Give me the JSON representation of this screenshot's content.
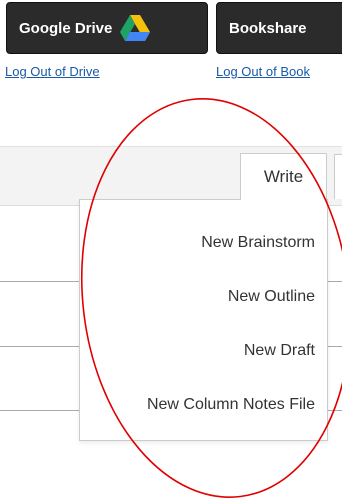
{
  "header": {
    "drive_button_label": "Google Drive",
    "bookshare_button_label": "Bookshare",
    "logout_drive_label": "Log Out of Drive",
    "logout_bookshare_label": "Log Out of Book"
  },
  "tabs": {
    "write_label": "Write"
  },
  "write_menu": {
    "items": [
      {
        "label": "New Brainstorm"
      },
      {
        "label": "New Outline"
      },
      {
        "label": "New Draft"
      },
      {
        "label": "New Column Notes File"
      }
    ]
  },
  "colors": {
    "button_bg": "#2b2b2b",
    "link": "#1a5aa6",
    "annotation_circle": "#e00000"
  },
  "icons": {
    "drive": "google-drive-logo"
  }
}
